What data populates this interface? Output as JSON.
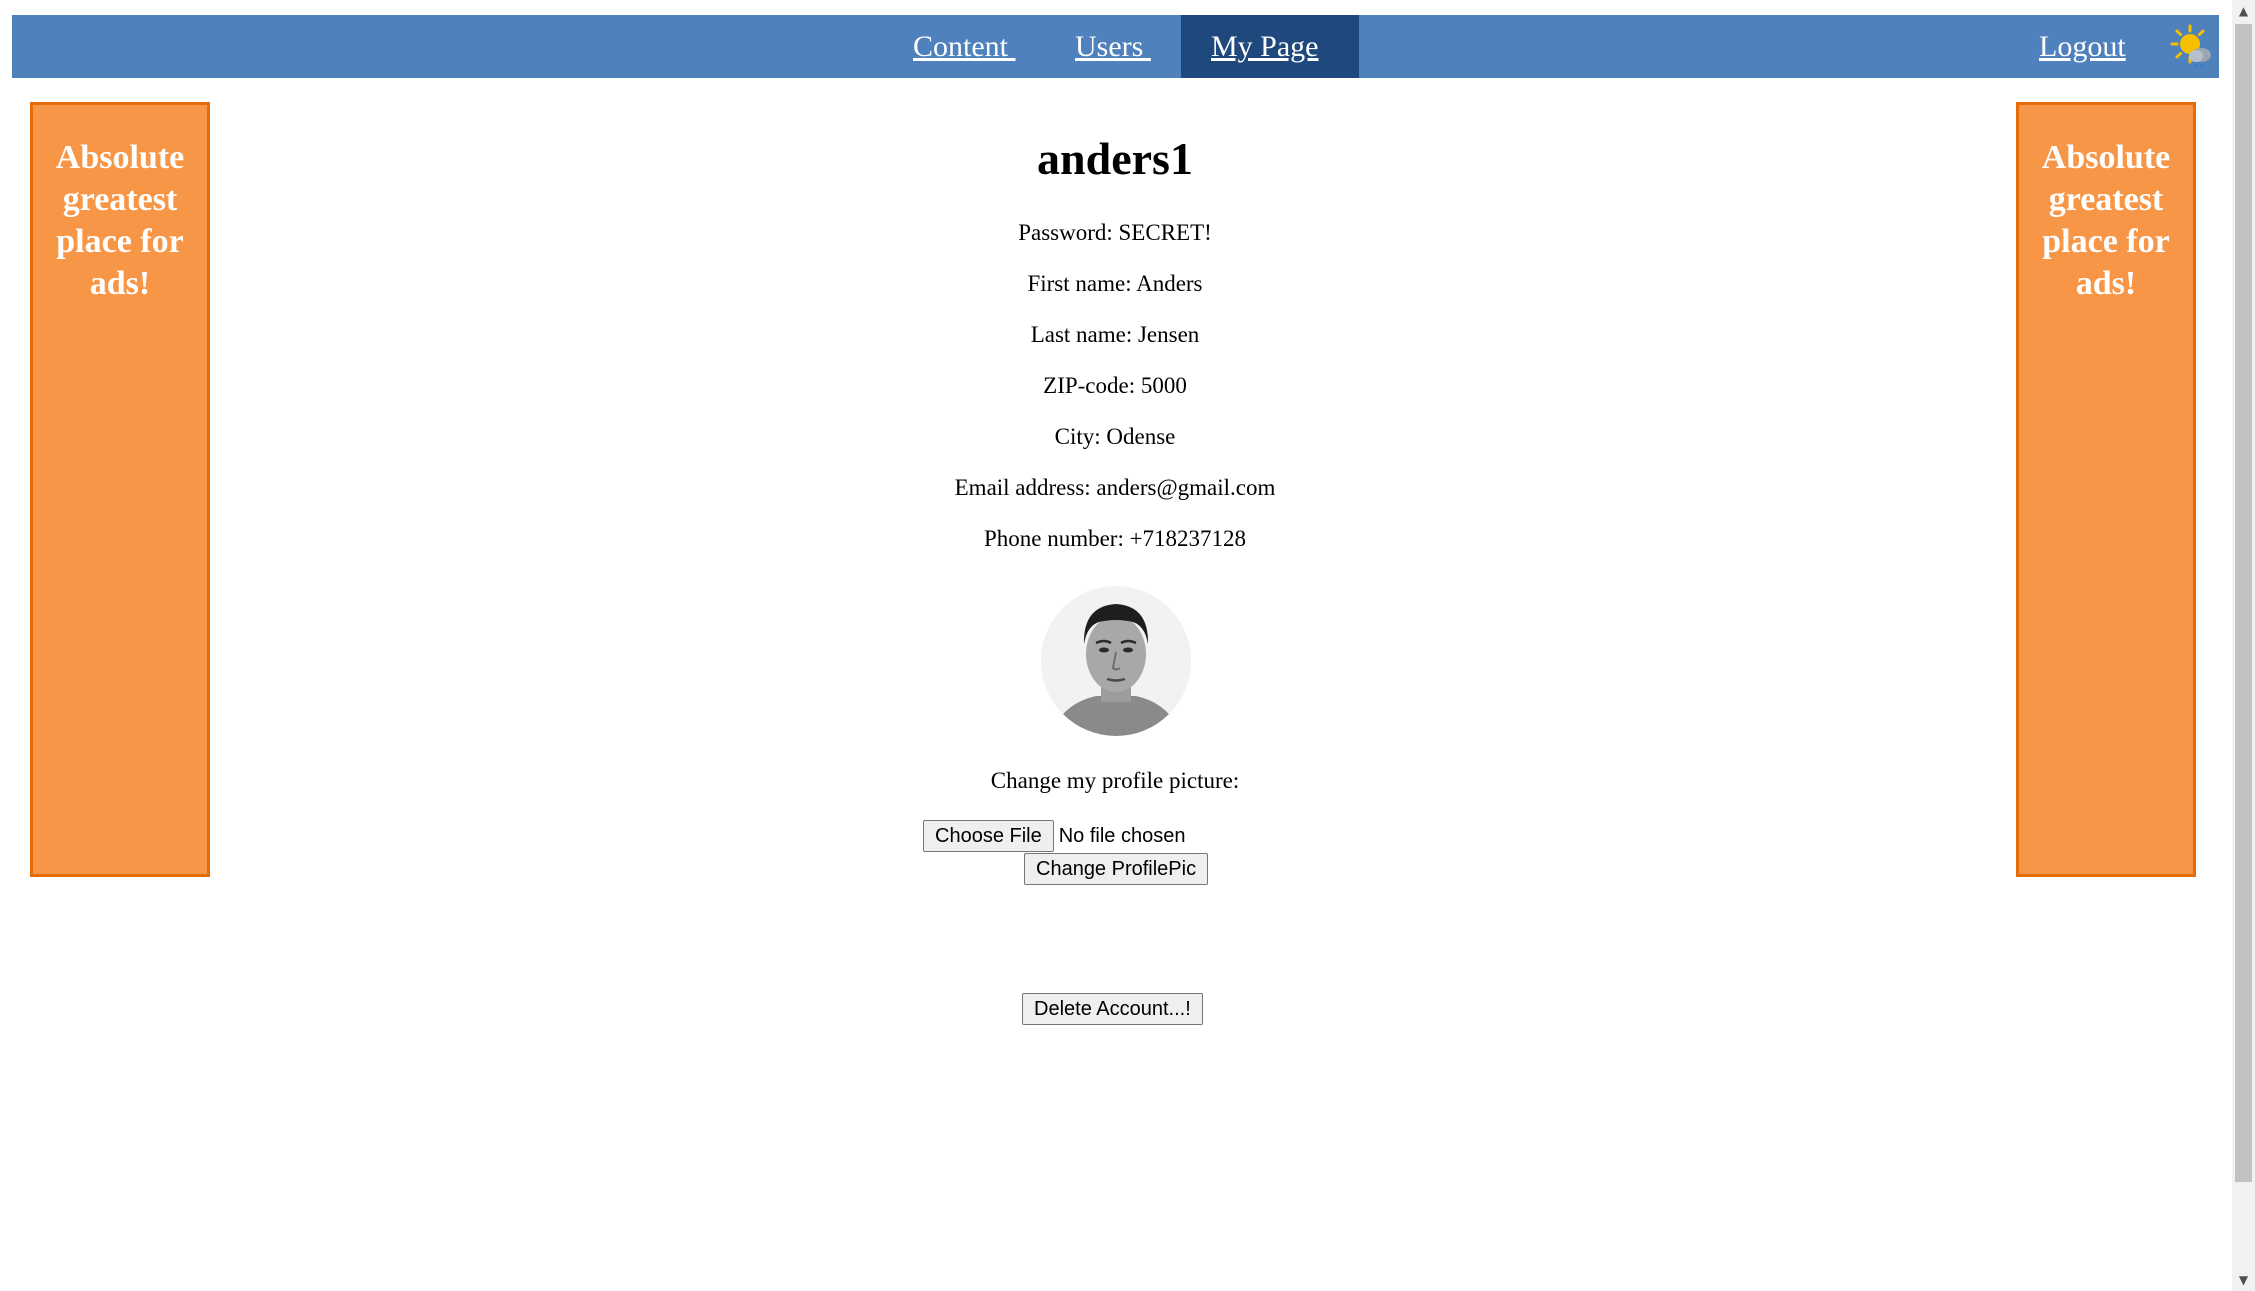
{
  "nav": {
    "links": [
      "Content ",
      "Users ",
      "My Page"
    ],
    "active": "My Page",
    "logout": "Logout",
    "weather_icon": "weather-sun-cloud-icon",
    "bar_color": "#4f81bd",
    "active_color": "#1f497d"
  },
  "ads": {
    "left_text": "Absolute greatest place for ads!",
    "right_text": "Absolute greatest place for ads!",
    "color": "#f79646"
  },
  "profile": {
    "username": "anders1",
    "password": "Password: SECRET!",
    "first_name": "First name: Anders",
    "last_name": "Last name: Jensen",
    "zip": "ZIP-code: 5000",
    "city": "City: Odense",
    "email": "Email address: anders@gmail.com",
    "phone": "Phone number: +718237128",
    "avatar_icon": "profile-photo"
  },
  "upload": {
    "label": "Change my profile picture:",
    "choose_file": "Choose File",
    "no_file": "No file chosen",
    "submit": "Change ProfilePic"
  },
  "account": {
    "delete": "Delete Account...!"
  }
}
